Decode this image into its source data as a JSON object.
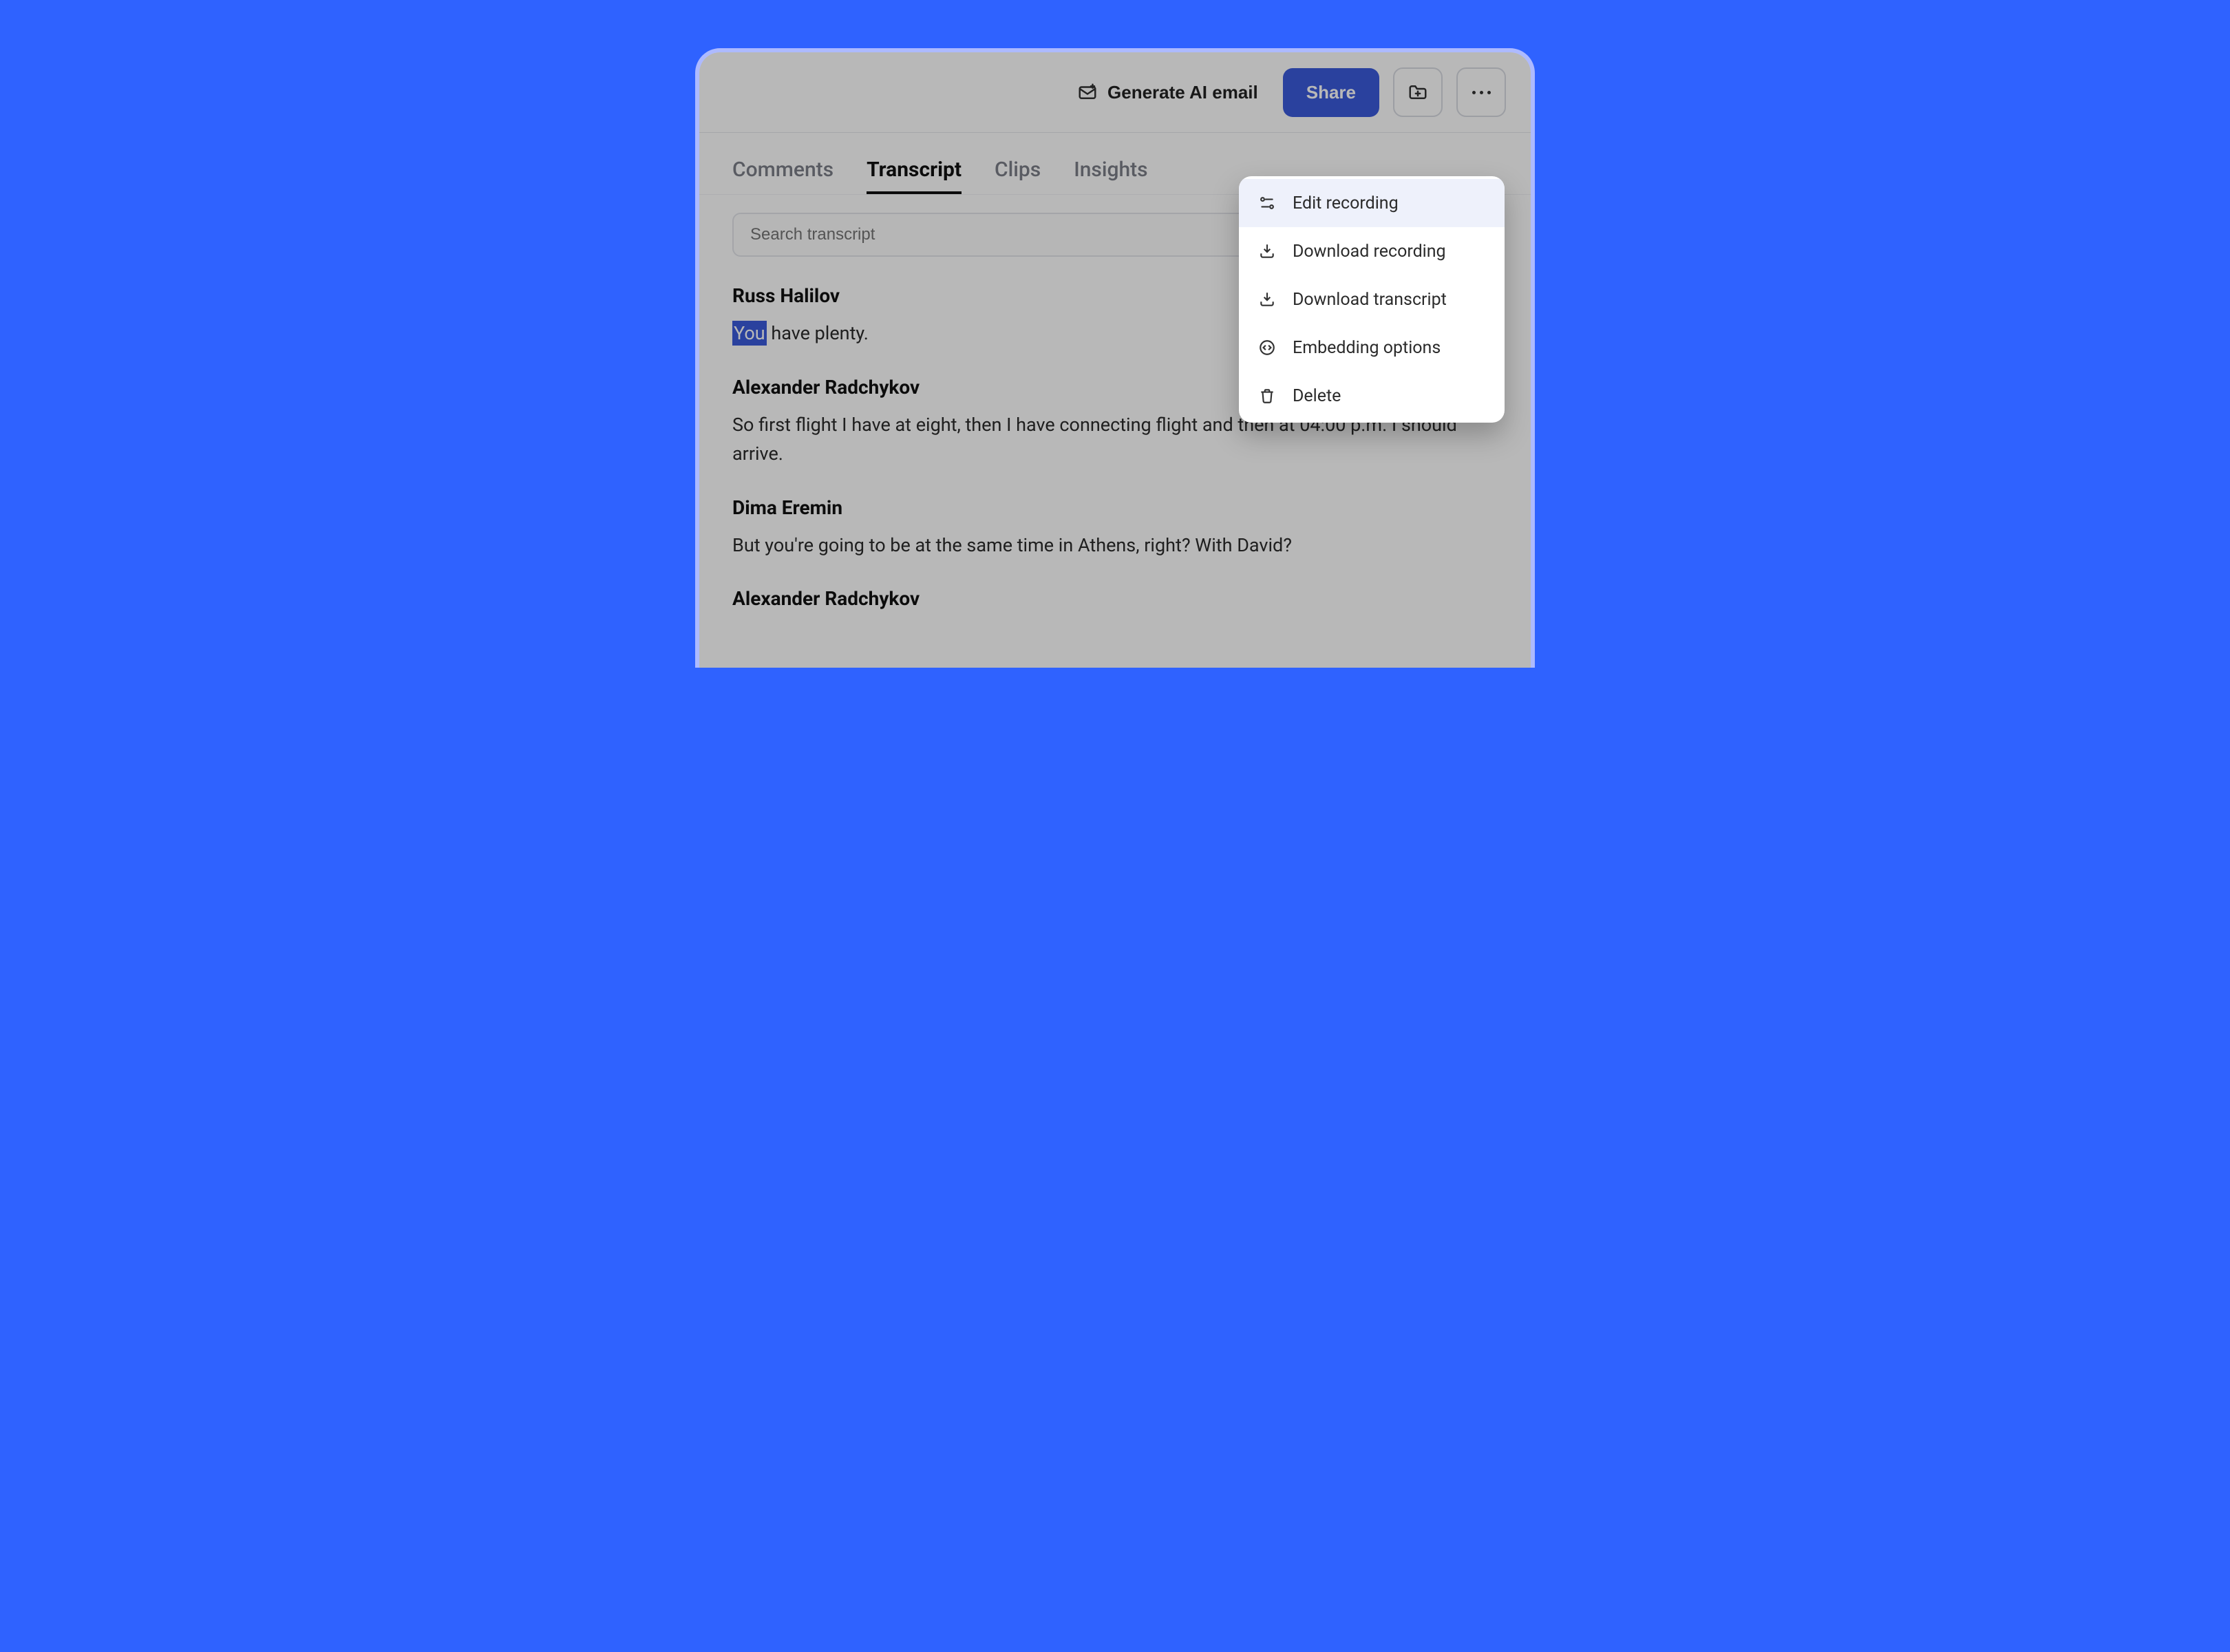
{
  "topbar": {
    "generate_ai": "Generate AI email",
    "share": "Share"
  },
  "tabs": [
    {
      "label": "Comments",
      "active": false
    },
    {
      "label": "Transcript",
      "active": true
    },
    {
      "label": "Clips",
      "active": false
    },
    {
      "label": "Insights",
      "active": false
    }
  ],
  "search": {
    "placeholder": "Search transcript"
  },
  "transcript": [
    {
      "speaker": "Russ Halilov",
      "highlighted_word": "You",
      "rest": " have plenty."
    },
    {
      "speaker": "Alexander Radchykov",
      "text": "So first flight I have at eight, then I have connecting flight and then at 04:00 p.m. I should arrive."
    },
    {
      "speaker": "Dima Eremin",
      "text": "But you're going to be at the same time in Athens, right? With David?"
    },
    {
      "speaker": "Alexander Radchykov",
      "text": ""
    }
  ],
  "menu": {
    "items": [
      {
        "label": "Edit recording",
        "icon": "edit-sliders-icon",
        "hovered": true
      },
      {
        "label": "Download recording",
        "icon": "download-icon",
        "hovered": false
      },
      {
        "label": "Download transcript",
        "icon": "download-icon",
        "hovered": false
      },
      {
        "label": "Embedding options",
        "icon": "code-circle-icon",
        "hovered": false
      },
      {
        "label": "Delete",
        "icon": "trash-icon",
        "hovered": false
      }
    ]
  }
}
